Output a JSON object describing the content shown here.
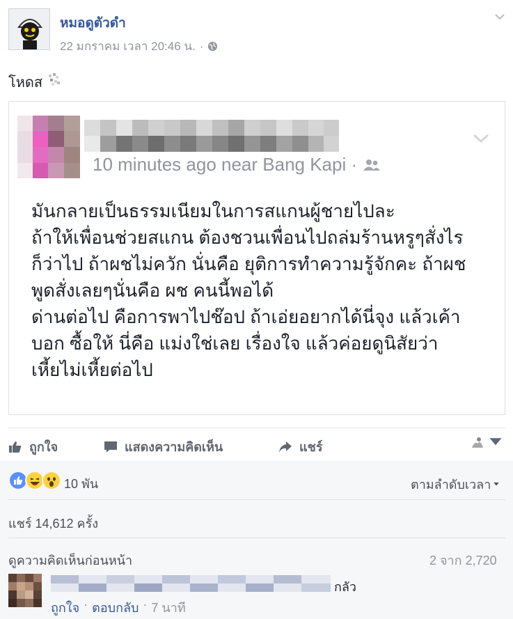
{
  "post": {
    "author": "หมอดูตัวดำ",
    "timestamp": "22 มกราคม เวลา 20:46 น.",
    "separator": "·",
    "text": "โหดส"
  },
  "shared": {
    "meta": "10 minutes ago near Bang Kapi ·",
    "lines": [
      "มันกลายเป็นธรรมเนียมในการสแกนผู้ชายไปละ",
      "ถ้าให้เพื่อนช่วยสแกน ต้องชวนเพื่อนไปถล่มร้านหรูๆสั่งไร",
      "ก็ว่าไป ถ้าผชไม่ควัก นั่นคือ ยุติการทำความรู้จักคะ ถ้าผช",
      "พูดสั่งเลยๆนั่นคือ ผช คนนี้พอได้",
      "ด่านต่อไป คือการพาไปช๊อป ถ้าเอ่ยอยากได้นี่จุง แล้วเค้า",
      "บอก ซื้อให้ นี่คือ แม่งใช่เลย เรื่องใจ แล้วค่อยดูนิสัยว่า",
      "เหี้ยไม่เหี้ยต่อไป"
    ]
  },
  "actions": {
    "like": "ถูกใจ",
    "comment": "แสดงความคิดเห็น",
    "share": "แชร์"
  },
  "feedback": {
    "reaction_count": "10 พัน",
    "sort_label": "ตามลำดับเวลา",
    "shares": "แชร์ 14,612 ครั้ง",
    "prev_comments": "ดูความคิดเห็นก่อนหน้า",
    "pager": "2 จาก 2,720"
  },
  "comment": {
    "text": "กลัว",
    "like": "ถูกใจ",
    "reply": "ตอบกลับ",
    "time": "7 นาที",
    "dot": "·"
  },
  "colors": {
    "link": "#365899",
    "meta": "#90949c",
    "like_blue": "#5890ff",
    "emoji_yellow": "#fcd33f",
    "feedback_bg": "#f6f7f9"
  },
  "icons": [
    "globe-icon",
    "chevron-down-icon",
    "friends-icon",
    "like-icon",
    "comment-icon",
    "share-icon",
    "like-reaction-icon",
    "haha-reaction-icon",
    "wow-reaction-icon"
  ]
}
